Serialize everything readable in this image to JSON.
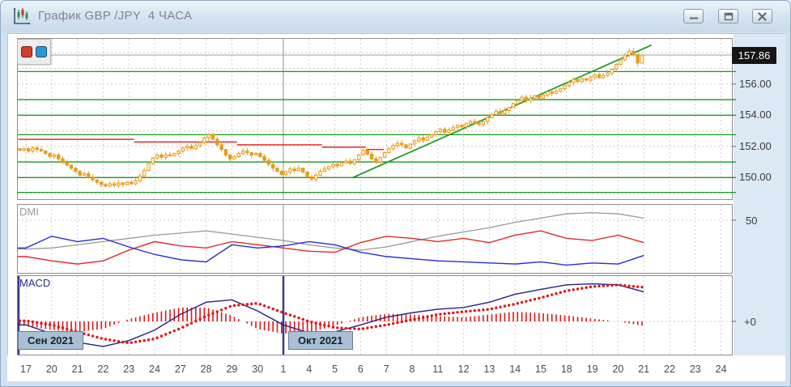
{
  "window": {
    "title": "График GBP /JPY  4 ЧАСА",
    "controls": [
      {
        "name": "minimize"
      },
      {
        "name": "restore"
      },
      {
        "name": "close"
      }
    ]
  },
  "toolbar": {
    "buttons": [
      {
        "name": "red-marker",
        "color": "#d23b2f"
      },
      {
        "name": "blue-marker",
        "color": "#2e95d3"
      }
    ]
  },
  "panels": {
    "dmi_label": "DMI",
    "macd_label": "MACD",
    "dmi_axis_label": "50",
    "macd_axis_label": "+0"
  },
  "price_axis": {
    "current": "157.86",
    "labels": [
      {
        "text": "156.00",
        "price": 156.0
      },
      {
        "text": "154.00",
        "price": 154.0
      },
      {
        "text": "152.00",
        "price": 152.0
      },
      {
        "text": "150.00",
        "price": 150.0
      }
    ]
  },
  "months": [
    {
      "label": "Сен 2021",
      "day_index": 0
    },
    {
      "label": "Окт 2021",
      "day_index": 10
    }
  ],
  "chart_data": {
    "type": "candlestick+indicators",
    "instrument": "GBP/JPY",
    "timeframe": "4 HOURS",
    "current_price": 157.86,
    "day_labels": [
      "17",
      "20",
      "21",
      "22",
      "23",
      "24",
      "27",
      "28",
      "29",
      "30",
      "1",
      "4",
      "5",
      "6",
      "7",
      "8",
      "11",
      "12",
      "13",
      "14",
      "15",
      "18",
      "19",
      "20",
      "21",
      "22",
      "23",
      "24"
    ],
    "data_days": 25,
    "candles_per_day": 6,
    "closes": [
      151.75,
      151.85,
      151.7,
      151.9,
      151.8,
      151.7,
      151.55,
      151.35,
      151.45,
      151.2,
      150.95,
      150.8,
      150.6,
      150.4,
      150.15,
      150.25,
      150.0,
      149.85,
      149.7,
      149.55,
      149.45,
      149.6,
      149.5,
      149.65,
      149.55,
      149.7,
      149.6,
      149.8,
      150.1,
      150.45,
      150.9,
      151.25,
      151.45,
      151.3,
      151.45,
      151.4,
      151.55,
      151.7,
      151.9,
      152.0,
      151.85,
      152.05,
      152.25,
      152.55,
      152.75,
      152.45,
      152.1,
      151.8,
      151.45,
      151.2,
      151.35,
      151.55,
      151.7,
      151.6,
      151.45,
      151.55,
      151.35,
      151.1,
      150.85,
      150.6,
      150.4,
      150.2,
      150.35,
      150.55,
      150.45,
      150.6,
      150.35,
      150.05,
      149.9,
      150.15,
      150.4,
      150.55,
      150.7,
      150.85,
      150.75,
      150.95,
      151.05,
      150.9,
      151.15,
      151.45,
      151.75,
      151.5,
      151.2,
      151.0,
      151.3,
      151.6,
      151.85,
      152.05,
      152.2,
      152.1,
      151.9,
      152.15,
      152.35,
      152.55,
      152.4,
      152.6,
      152.75,
      152.95,
      153.1,
      152.9,
      153.05,
      153.2,
      153.35,
      153.25,
      153.45,
      153.6,
      153.5,
      153.4,
      153.6,
      153.85,
      154.05,
      154.25,
      154.1,
      154.3,
      154.5,
      154.75,
      154.95,
      155.15,
      154.95,
      155.1,
      155.25,
      155.1,
      155.3,
      155.5,
      155.4,
      155.55,
      155.7,
      155.9,
      156.1,
      156.3,
      156.15,
      156.35,
      156.25,
      156.45,
      156.6,
      156.4,
      156.55,
      156.7,
      156.95,
      157.25,
      157.55,
      157.85,
      158.1,
      157.9,
      157.35,
      157.86
    ],
    "levels_green": [
      156.8,
      155.0,
      154.0,
      152.75,
      151.0,
      150.0,
      149.05
    ],
    "resistance_steps": [
      [
        -0.3,
        4.2,
        152.45
      ],
      [
        4.2,
        8.2,
        152.28
      ],
      [
        8.2,
        11.5,
        152.1
      ],
      [
        11.5,
        13.2,
        151.95
      ],
      [
        13.2,
        13.9,
        151.8
      ]
    ],
    "trendline": {
      "d1": 12.7,
      "p1": 150.0,
      "d2": 24.3,
      "p2": 158.5
    },
    "grid_prices": [
      149,
      150,
      151,
      152,
      153,
      154,
      155,
      156,
      157,
      158
    ],
    "dmi": {
      "level": 50,
      "adx": [
        23,
        24,
        27,
        30,
        33,
        36,
        38,
        40,
        37,
        34,
        31,
        27,
        24,
        22,
        25,
        30,
        35,
        39,
        43,
        48,
        52,
        56,
        57,
        56,
        52
      ],
      "plus_di": [
        16,
        12,
        9,
        12,
        22,
        30,
        26,
        24,
        30,
        27,
        24,
        21,
        20,
        29,
        35,
        33,
        30,
        33,
        29,
        36,
        40,
        33,
        31,
        36,
        29
      ],
      "minus_di": [
        24,
        35,
        30,
        33,
        25,
        18,
        13,
        11,
        27,
        24,
        26,
        30,
        27,
        20,
        16,
        14,
        12,
        11,
        10,
        9,
        11,
        8,
        10,
        9,
        17
      ]
    },
    "macd": {
      "macd": [
        -0.1,
        -0.35,
        -0.6,
        -0.72,
        -0.55,
        -0.25,
        0.2,
        0.55,
        0.62,
        0.3,
        -0.1,
        -0.33,
        -0.3,
        -0.1,
        0.12,
        0.25,
        0.35,
        0.4,
        0.55,
        0.78,
        0.92,
        1.05,
        1.08,
        1.05,
        0.85
      ],
      "signal": [
        0.02,
        -0.1,
        -0.3,
        -0.5,
        -0.62,
        -0.5,
        -0.2,
        0.15,
        0.45,
        0.52,
        0.25,
        0.0,
        -0.18,
        -0.22,
        -0.1,
        0.05,
        0.2,
        0.28,
        0.35,
        0.5,
        0.68,
        0.88,
        1.0,
        1.05,
        0.98
      ]
    },
    "colors": {
      "candle": "#e89c1c",
      "candle_fill_up": "#fff6e2",
      "green_level": "#189a1e",
      "trend": "#189a1e",
      "resistance": "#e22a2a",
      "adx": "#9a9a9a",
      "plus_di": "#dd2c2c",
      "minus_di": "#2b2bd4",
      "macd_line": "#22228c",
      "signal": "#e01515",
      "hist": "#e01515",
      "grid": "#cccccc",
      "month_line": "#8c8c8c",
      "macd_month_line": "#3b3b8f",
      "cur_price_line": "#a3a3a3"
    }
  }
}
